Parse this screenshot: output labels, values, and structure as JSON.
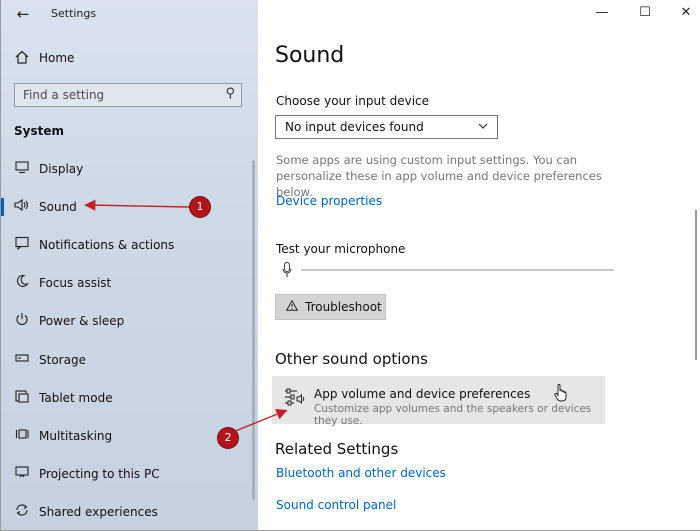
{
  "window": {
    "title": "Settings"
  },
  "titlebar": {
    "back_icon": "back-arrow-icon",
    "minimize": "—",
    "maximize": "☐",
    "close": "✕"
  },
  "sidebar": {
    "home_label": "Home",
    "search_placeholder": "Find a setting",
    "section_heading": "System",
    "items": [
      {
        "label": "Display",
        "icon": "display-icon",
        "glyph": "▭"
      },
      {
        "label": "Sound",
        "icon": "speaker-icon",
        "glyph": "🔈",
        "selected": true
      },
      {
        "label": "Notifications & actions",
        "icon": "notifications-icon",
        "glyph": "▢"
      },
      {
        "label": "Focus assist",
        "icon": "moon-icon",
        "glyph": "☽"
      },
      {
        "label": "Power & sleep",
        "icon": "power-icon",
        "glyph": "⏻"
      },
      {
        "label": "Storage",
        "icon": "storage-icon",
        "glyph": "▭"
      },
      {
        "label": "Tablet mode",
        "icon": "tablet-mode-icon",
        "glyph": "⧉"
      },
      {
        "label": "Multitasking",
        "icon": "multitasking-icon",
        "glyph": "⊟"
      },
      {
        "label": "Projecting to this PC",
        "icon": "projector-icon",
        "glyph": "▭"
      },
      {
        "label": "Shared experiences",
        "icon": "shared-experiences-icon",
        "glyph": "⟳"
      }
    ]
  },
  "main": {
    "page_title": "Sound",
    "input_device_label": "Choose your input device",
    "input_device_value": "No input devices found",
    "input_desc": "Some apps are using custom input settings. You can personalize these in app volume and device preferences below.",
    "device_properties_link": "Device properties",
    "test_mic_label": "Test your microphone",
    "mic_level": 0,
    "troubleshoot_label": "Troubleshoot",
    "other_options_heading": "Other sound options",
    "app_volume_title": "App volume and device preferences",
    "app_volume_sub": "Customize app volumes and the speakers or devices they use.",
    "related_heading": "Related Settings",
    "related_links": [
      "Bluetooth and other devices",
      "Sound control panel"
    ]
  },
  "annotations": {
    "callout_1": "1",
    "callout_2": "2",
    "color": "#b1141c"
  }
}
